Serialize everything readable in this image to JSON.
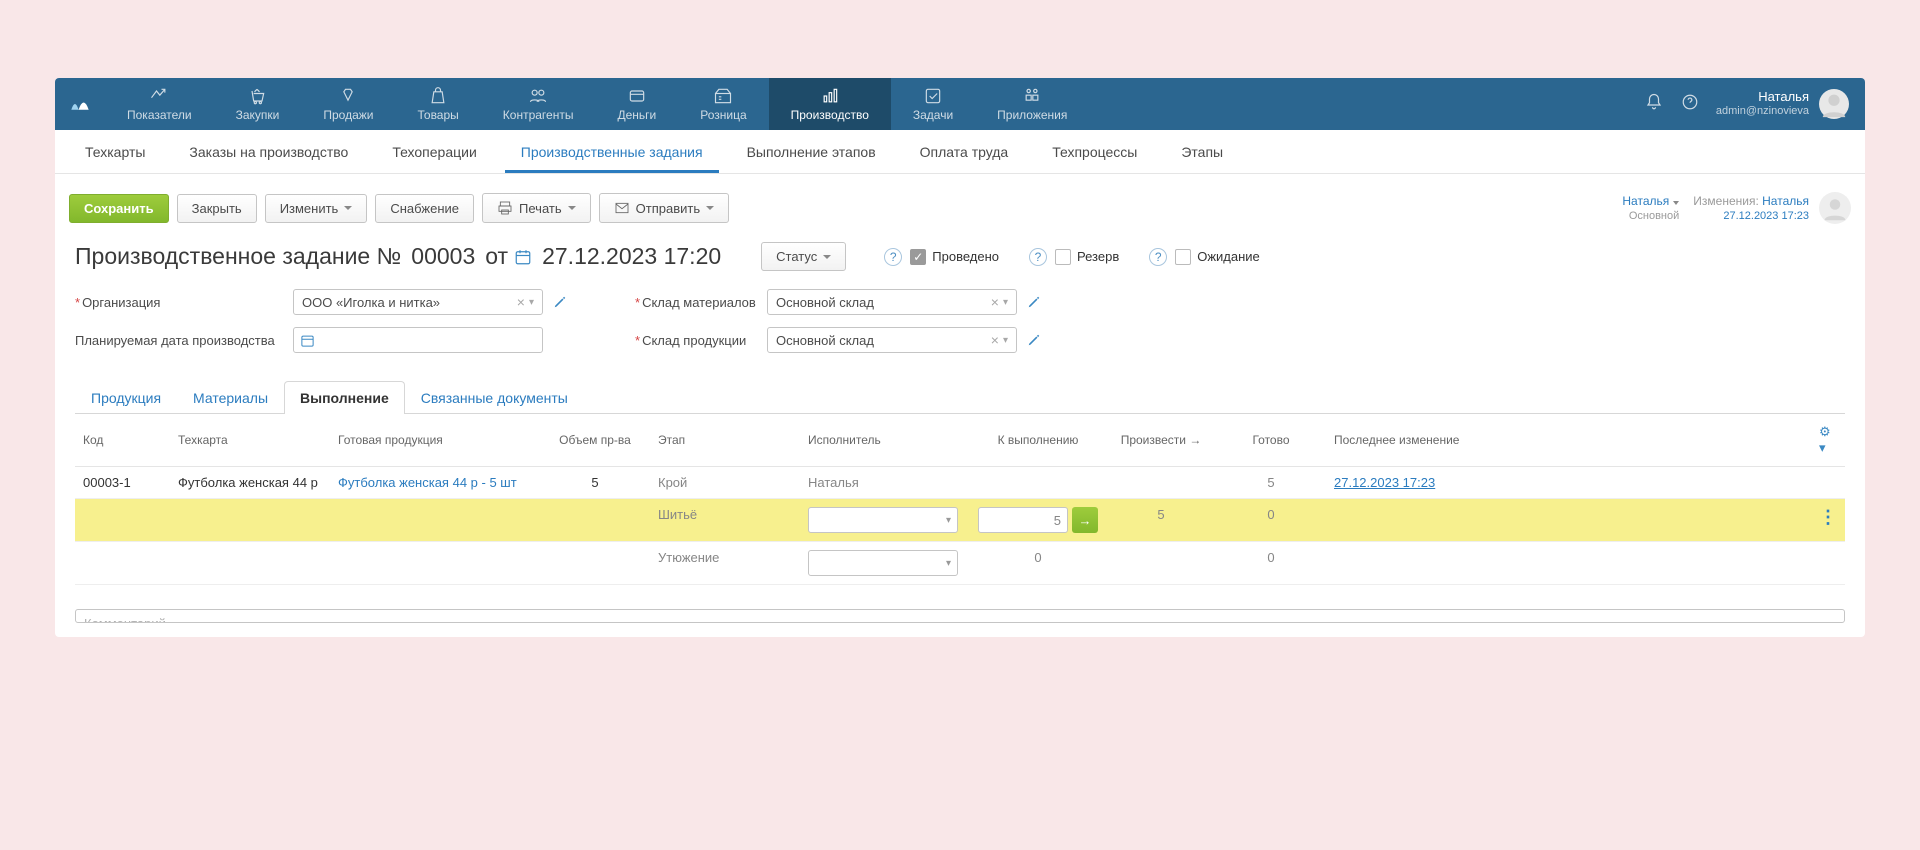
{
  "top_nav": {
    "items": [
      "Показатели",
      "Закупки",
      "Продажи",
      "Товары",
      "Контрагенты",
      "Деньги",
      "Розница",
      "Производство",
      "Задачи",
      "Приложения"
    ],
    "active_index": 7
  },
  "user": {
    "name": "Наталья",
    "email": "admin@nzinovieva"
  },
  "sub_nav": {
    "items": [
      "Техкарты",
      "Заказы на производство",
      "Техоперации",
      "Производственные задания",
      "Выполнение этапов",
      "Оплата труда",
      "Техпроцессы",
      "Этапы"
    ],
    "active_index": 3
  },
  "toolbar": {
    "save": "Сохранить",
    "close": "Закрыть",
    "change": "Изменить",
    "supply": "Снабжение",
    "print": "Печать",
    "send": "Отправить",
    "owner": {
      "name": "Наталья",
      "role": "Основной"
    },
    "changes": {
      "label": "Изменения:",
      "name": "Наталья",
      "date": "27.12.2023 17:23"
    }
  },
  "doc": {
    "title_label": "Производственное задание №",
    "number": "00003",
    "from": "от",
    "date": "27.12.2023 17:20",
    "status_label": "Статус",
    "checks": {
      "provedeno": {
        "label": "Проведено",
        "checked": true
      },
      "rezerv": {
        "label": "Резерв",
        "checked": false
      },
      "wait": {
        "label": "Ожидание",
        "checked": false
      }
    }
  },
  "fields": {
    "org": {
      "label": "Организация",
      "value": "ООО «Иголка и нитка»",
      "required": true
    },
    "plan_date": {
      "label": "Планируемая дата производства",
      "value": ""
    },
    "mat_store": {
      "label": "Склад материалов",
      "value": "Основной склад",
      "required": true
    },
    "prod_store": {
      "label": "Склад продукции",
      "value": "Основной склад",
      "required": true
    }
  },
  "tabs": {
    "items": [
      "Продукция",
      "Материалы",
      "Выполнение",
      "Связанные документы"
    ],
    "active_index": 2
  },
  "grid": {
    "headers": [
      "Код",
      "Техкарта",
      "Готовая продукция",
      "Объем пр-ва",
      "Этап",
      "Исполнитель",
      "К выполнению",
      "Произвести →",
      "Готово",
      "Последнее изменение"
    ],
    "row": {
      "code": "00003-1",
      "techcard": "Футболка женская 44 р",
      "product": "Футболка женская 44 р - 5 шт",
      "volume": "5"
    },
    "stages": [
      {
        "name": "Крой",
        "executor": "Наталья",
        "to_do": "",
        "produce": "",
        "done": "5",
        "last_change": "27.12.2023 17:23",
        "active": false,
        "editable": false
      },
      {
        "name": "Шитьё",
        "executor": "",
        "to_do": "5",
        "produce": "5",
        "done": "0",
        "last_change": "",
        "active": true,
        "editable": true
      },
      {
        "name": "Утюжение",
        "executor": "",
        "to_do": "0",
        "produce": "",
        "done": "0",
        "last_change": "",
        "active": false,
        "editable": true
      }
    ]
  },
  "comment_placeholder": "Комментарий"
}
